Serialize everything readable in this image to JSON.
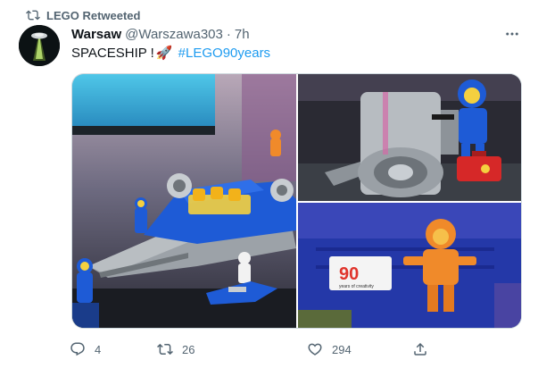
{
  "retweet": {
    "label": "LEGO Retweeted"
  },
  "author": {
    "name": "Warsaw",
    "handle": "@Warszawa303",
    "separator": "·",
    "time": "7h"
  },
  "tweet": {
    "text_before": "SPACESHIP !",
    "rocket_emoji": "🚀",
    "hashtag": "#LEGO90years"
  },
  "media": {
    "logo_text_top": "90",
    "logo_text_bottom": "years of creativity"
  },
  "actions": {
    "reply_count": "4",
    "retweet_count": "26",
    "like_count": "294"
  },
  "colors": {
    "text": "#0f1419",
    "secondary": "#536471",
    "link": "#1d9bf0",
    "lego_blue": "#1e5bd6",
    "lego_yellow": "#f4d03f",
    "lego_orange": "#f08a2a"
  }
}
